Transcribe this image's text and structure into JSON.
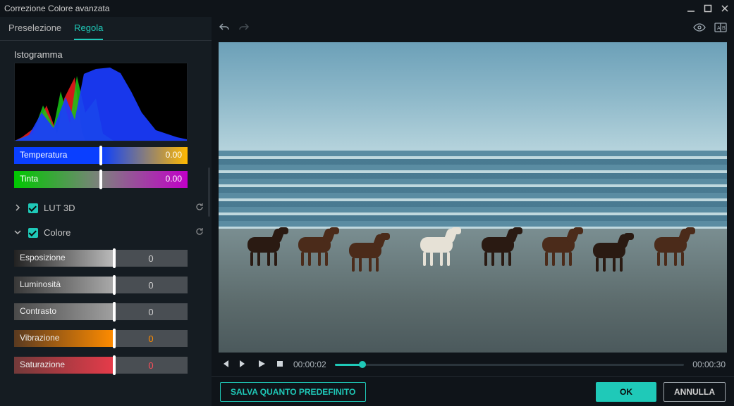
{
  "window": {
    "title": "Correzione Colore avanzata"
  },
  "tabs": {
    "preset": "Preselezione",
    "adjust": "Regola"
  },
  "histogram": {
    "label": "Istogramma"
  },
  "temp": {
    "label": "Temperatura",
    "value": "0.00"
  },
  "tint": {
    "label": "Tinta",
    "value": "0.00"
  },
  "lut": {
    "label": "LUT 3D"
  },
  "color": {
    "label": "Colore"
  },
  "sliders": {
    "exposure": {
      "label": "Esposizione",
      "value": "0"
    },
    "brightness": {
      "label": "Luminosità",
      "value": "0"
    },
    "contrast": {
      "label": "Contrasto",
      "value": "0"
    },
    "vibrance": {
      "label": "Vibrazione",
      "value": "0"
    },
    "saturation": {
      "label": "Saturazione",
      "value": "0"
    }
  },
  "playbar": {
    "current": "00:00:02",
    "total": "00:00:30"
  },
  "buttons": {
    "savePreset": "SALVA QUANTO PREDEFINITO",
    "ok": "OK",
    "cancel": "ANNULLA"
  }
}
